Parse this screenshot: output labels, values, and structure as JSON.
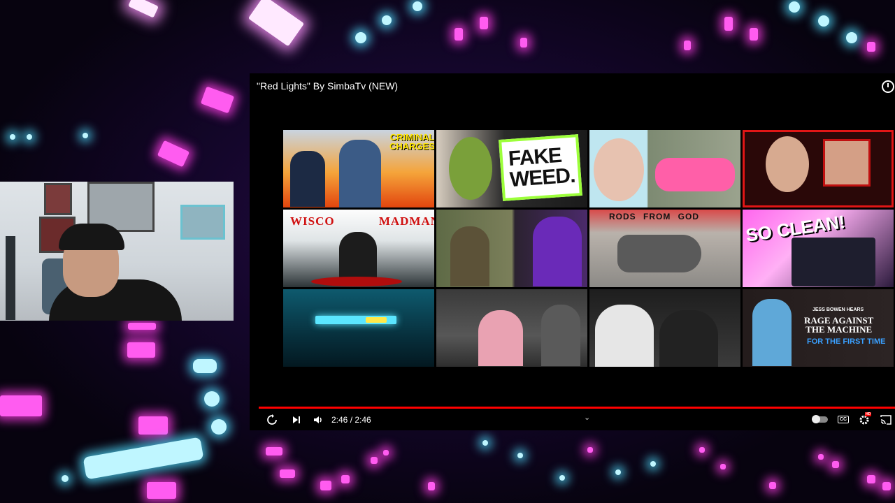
{
  "player": {
    "title": "\"Red Lights\" By SimbaTv (NEW)",
    "time_current": "2:46",
    "time_sep": " / ",
    "time_total": "2:46",
    "progress": 1.0,
    "accent": "#ff0000",
    "cc_label": "CC",
    "hd_badge": "HD"
  },
  "end_screen": {
    "tiles": [
      {
        "caption": "CRIMINAL\nCHARGES",
        "caption_color": "#ffe600"
      },
      {
        "caption": "FAKE\nWEED.",
        "caption_color": "#111111"
      },
      {
        "caption": "",
        "caption_color": ""
      },
      {
        "caption": "",
        "caption_color": ""
      },
      {
        "caption": "WISCO MADMAN",
        "caption_color": "#d01010"
      },
      {
        "caption": "",
        "caption_color": ""
      },
      {
        "caption": "RODS FROM GOD",
        "caption_color": "#111111"
      },
      {
        "caption": "SO CLEAN!",
        "caption_color": "#ffffff"
      },
      {
        "caption": "",
        "caption_color": ""
      },
      {
        "caption": "",
        "caption_color": ""
      },
      {
        "caption": "",
        "caption_color": ""
      },
      {
        "caption_small": "JESS BOWEN HEARS",
        "caption": "RAGE AGAINST\nTHE MACHINE",
        "caption_sub": "FOR THE FIRST TIME",
        "caption_color": "#ffffff",
        "caption_sub_color": "#3aa0ff"
      }
    ]
  },
  "colors": {
    "background": "#0b0518",
    "magenta_light": "#ff5cf0",
    "cyan_light": "#80dcff"
  }
}
